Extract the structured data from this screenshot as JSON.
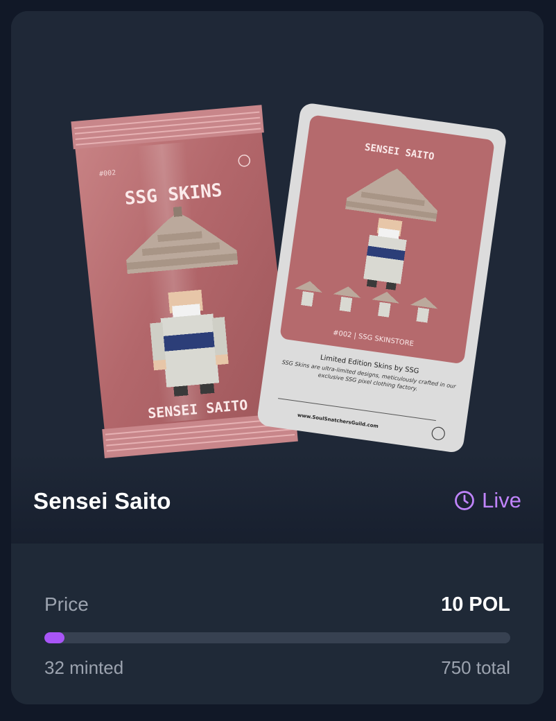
{
  "item": {
    "title": "Sensei Saito",
    "status": "Live",
    "status_icon": "clock-icon"
  },
  "artwork": {
    "pack_label": "SSG SKINS",
    "pack_number": "#002",
    "pack_name": "SENSEI SAITO",
    "card_name": "SENSEI SAITO",
    "card_store": "#002 | SSG SKINSTORE",
    "card_heading": "Limited Edition Skins by SSG",
    "card_blurb": "SSG Skins are ultra-limited designs, meticulously crafted in our exclusive SSG pixel clothing factory.",
    "card_url": "www.SoulSnatchersGuild.com"
  },
  "sale": {
    "price_label": "Price",
    "price_value": "10 POL",
    "minted_label": "32 minted",
    "total_label": "750 total",
    "minted_fraction": 0.0427
  },
  "colors": {
    "accent": "#a855f7",
    "status": "#c084fc",
    "panel": "#1f2937",
    "page": "#111827",
    "pack": "#b5696c"
  }
}
